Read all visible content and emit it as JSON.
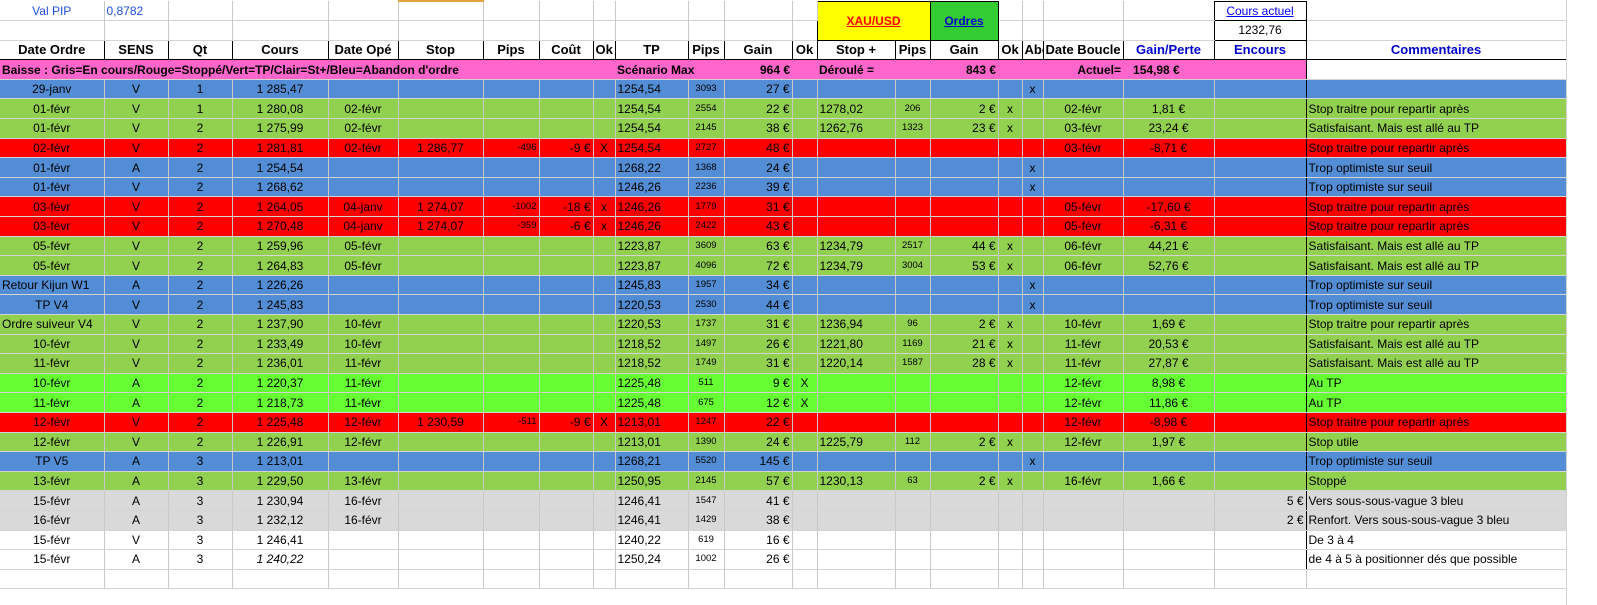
{
  "top": {
    "val_pip_label": "Val PIP",
    "val_pip_value": "0,8782",
    "xau_usd": "XAU/USD",
    "ordres": "Ordres",
    "cours_actuel_label": "Cours actuel",
    "cours_actuel_value": "1232,76"
  },
  "headers": [
    "Date Ordre",
    "SENS",
    "Qt",
    "Cours",
    "Date Opé",
    "Stop",
    "Pips",
    "Coût",
    "Ok",
    "TP",
    "Pips",
    "Gain",
    "Ok",
    "Stop +",
    "Pips",
    "Gain",
    "Ok",
    "Abd",
    "Date Boucle",
    "Gain/Perte",
    "Encours",
    "Commentaires"
  ],
  "legend": {
    "text": "Baisse : Gris=En cours/Rouge=Stoppé/Vert=TP/Clair=St+/Bleu=Abandon d'ordre",
    "scenario_label": "Scénario Max",
    "scenario_value": "964 €",
    "deroule_label": "Déroulé =",
    "deroule_value": "843 €",
    "actuel_label": "Actuel=",
    "actuel_value": "154,98 €"
  },
  "rows": [
    {
      "s": "blue",
      "c": [
        "29-janv",
        "V",
        "1",
        "1 285,47",
        "",
        "",
        "",
        "",
        "",
        "1254,54",
        "3093",
        "27 €",
        "",
        "",
        "",
        "",
        "",
        "x",
        "",
        "",
        "",
        ""
      ]
    },
    {
      "s": "green",
      "c": [
        "01-févr",
        "V",
        "1",
        "1 280,08",
        "02-févr",
        "",
        "",
        "",
        "",
        "1254,54",
        "2554",
        "22 €",
        "",
        "1278,02",
        "206",
        "2 €",
        "x",
        "",
        "02-févr",
        "1,81 €",
        "",
        "Stop traitre pour repartir après"
      ]
    },
    {
      "s": "green",
      "c": [
        "01-févr",
        "V",
        "2",
        "1 275,99",
        "02-févr",
        "",
        "",
        "",
        "",
        "1254,54",
        "2145",
        "38 €",
        "",
        "1262,76",
        "1323",
        "23 €",
        "x",
        "",
        "03-févr",
        "23,24 €",
        "",
        "Satisfaisant. Mais est allé au TP"
      ]
    },
    {
      "s": "red",
      "c": [
        "02-févr",
        "V",
        "2",
        "1 281,81",
        "02-févr",
        "1 286,77",
        "-496",
        "-9 €",
        "X",
        "1254,54",
        "2727",
        "48 €",
        "",
        "",
        "",
        "",
        "",
        "",
        "03-févr",
        "-8,71 €",
        "",
        "Stop traitre pour repartir après"
      ]
    },
    {
      "s": "blue",
      "c": [
        "01-févr",
        "A",
        "2",
        "1 254,54",
        "",
        "",
        "",
        "",
        "",
        "1268,22",
        "1368",
        "24 €",
        "",
        "",
        "",
        "",
        "",
        "x",
        "",
        "",
        "",
        "Trop optimiste sur seuil"
      ]
    },
    {
      "s": "blue",
      "c": [
        "01-févr",
        "V",
        "2",
        "1 268,62",
        "",
        "",
        "",
        "",
        "",
        "1246,26",
        "2236",
        "39 €",
        "",
        "",
        "",
        "",
        "",
        "x",
        "",
        "",
        "",
        "Trop optimiste sur seuil"
      ]
    },
    {
      "s": "red",
      "c": [
        "03-févr",
        "V",
        "2",
        "1 264,05",
        "04-janv",
        "1 274,07",
        "-1002",
        "-18 €",
        "x",
        "1246,26",
        "1779",
        "31 €",
        "",
        "",
        "",
        "",
        "",
        "",
        "05-févr",
        "-17,60 €",
        "",
        "Stop traitre pour repartir après"
      ]
    },
    {
      "s": "red",
      "c": [
        "03-févr",
        "V",
        "2",
        "1 270,48",
        "04-janv",
        "1 274,07",
        "-359",
        "-6 €",
        "x",
        "1246,26",
        "2422",
        "43 €",
        "",
        "",
        "",
        "",
        "",
        "",
        "05-févr",
        "-6,31 €",
        "",
        "Stop traitre pour repartir après"
      ]
    },
    {
      "s": "green",
      "c": [
        "05-févr",
        "V",
        "2",
        "1 259,96",
        "05-févr",
        "",
        "",
        "",
        "",
        "1223,87",
        "3609",
        "63 €",
        "",
        "1234,79",
        "2517",
        "44 €",
        "x",
        "",
        "06-févr",
        "44,21 €",
        "",
        "Satisfaisant. Mais est allé au TP"
      ]
    },
    {
      "s": "green",
      "c": [
        "05-févr",
        "V",
        "2",
        "1 264,83",
        "05-févr",
        "",
        "",
        "",
        "",
        "1223,87",
        "4096",
        "72 €",
        "",
        "1234,79",
        "3004",
        "53 €",
        "x",
        "",
        "06-févr",
        "52,76 €",
        "",
        "Satisfaisant. Mais est allé au TP"
      ]
    },
    {
      "s": "blue",
      "c": [
        "Retour Kijun W1",
        "A",
        "2",
        "1 226,26",
        "",
        "",
        "",
        "",
        "",
        "1245,83",
        "1957",
        "34 €",
        "",
        "",
        "",
        "",
        "",
        "x",
        "",
        "",
        "",
        "Trop optimiste sur seuil"
      ]
    },
    {
      "s": "blue",
      "c": [
        "TP V4",
        "V",
        "2",
        "1 245,83",
        "",
        "",
        "",
        "",
        "",
        "1220,53",
        "2530",
        "44 €",
        "",
        "",
        "",
        "",
        "",
        "x",
        "",
        "",
        "",
        "Trop optimiste sur seuil"
      ]
    },
    {
      "s": "green",
      "c": [
        "Ordre suiveur V4",
        "V",
        "2",
        "1 237,90",
        "10-févr",
        "",
        "",
        "",
        "",
        "1220,53",
        "1737",
        "31 €",
        "",
        "1236,94",
        "96",
        "2 €",
        "x",
        "",
        "10-févr",
        "1,69 €",
        "",
        "Stop traitre pour repartir après"
      ]
    },
    {
      "s": "green",
      "c": [
        "10-févr",
        "V",
        "2",
        "1 233,49",
        "10-févr",
        "",
        "",
        "",
        "",
        "1218,52",
        "1497",
        "26 €",
        "",
        "1221,80",
        "1169",
        "21 €",
        "x",
        "",
        "11-févr",
        "20,53 €",
        "",
        "Satisfaisant. Mais est allé au TP"
      ]
    },
    {
      "s": "green",
      "c": [
        "11-févr",
        "V",
        "2",
        "1 236,01",
        "11-févr",
        "",
        "",
        "",
        "",
        "1218,52",
        "1749",
        "31 €",
        "",
        "1220,14",
        "1587",
        "28 €",
        "x",
        "",
        "11-févr",
        "27,87 €",
        "",
        "Satisfaisant. Mais est allé au TP"
      ]
    },
    {
      "s": "lgreen",
      "c": [
        "10-févr",
        "A",
        "2",
        "1 220,37",
        "11-févr",
        "",
        "",
        "",
        "",
        "1225,48",
        "511",
        "9 €",
        "X",
        "",
        "",
        "",
        "",
        "",
        "12-févr",
        "8,98 €",
        "",
        "Au TP"
      ]
    },
    {
      "s": "lgreen",
      "c": [
        "11-févr",
        "A",
        "2",
        "1 218,73",
        "11-févr",
        "",
        "",
        "",
        "",
        "1225,48",
        "675",
        "12 €",
        "X",
        "",
        "",
        "",
        "",
        "",
        "12-févr",
        "11,86 €",
        "",
        "Au TP"
      ]
    },
    {
      "s": "red",
      "c": [
        "12-févr",
        "V",
        "2",
        "1 225,48",
        "12-févr",
        "1 230,59",
        "-511",
        "-9 €",
        "X",
        "1213,01",
        "1247",
        "22 €",
        "",
        "",
        "",
        "",
        "",
        "",
        "12-févr",
        "-8,98 €",
        "",
        "Stop traitre pour repartir après"
      ]
    },
    {
      "s": "green",
      "c": [
        "12-févr",
        "V",
        "2",
        "1 226,91",
        "12-févr",
        "",
        "",
        "",
        "",
        "1213,01",
        "1390",
        "24 €",
        "",
        "1225,79",
        "112",
        "2 €",
        "x",
        "",
        "12-févr",
        "1,97 €",
        "",
        "Stop utile"
      ]
    },
    {
      "s": "blue",
      "c": [
        "TP V5",
        "A",
        "3",
        "1 213,01",
        "",
        "",
        "",
        "",
        "",
        "1268,21",
        "5520",
        "145 €",
        "",
        "",
        "",
        "",
        "",
        "x",
        "",
        "",
        "",
        "Trop optimiste sur seuil"
      ]
    },
    {
      "s": "green",
      "c": [
        "13-févr",
        "A",
        "3",
        "1 229,50",
        "13-févr",
        "",
        "",
        "",
        "",
        "1250,95",
        "2145",
        "57 €",
        "",
        "1230,13",
        "63",
        "2 €",
        "x",
        "",
        "16-févr",
        "1,66 €",
        "",
        "Stoppé"
      ]
    },
    {
      "s": "grey",
      "c": [
        "15-févr",
        "A",
        "3",
        "1 230,94",
        "16-févr",
        "",
        "",
        "",
        "",
        "1246,41",
        "1547",
        "41 €",
        "",
        "",
        "",
        "",
        "",
        "",
        "",
        "",
        "5 €",
        "Vers sous-sous-vague 3 bleu"
      ]
    },
    {
      "s": "grey",
      "c": [
        "16-févr",
        "A",
        "3",
        "1 232,12",
        "16-févr",
        "",
        "",
        "",
        "",
        "1246,41",
        "1429",
        "38 €",
        "",
        "",
        "",
        "",
        "",
        "",
        "",
        "",
        "2 €",
        "Renfort. Vers sous-sous-vague 3 bleu"
      ]
    },
    {
      "s": "white",
      "c": [
        "15-févr",
        "V",
        "3",
        "1 246,41",
        "",
        "",
        "",
        "",
        "",
        "1240,22",
        "619",
        "16 €",
        "",
        "",
        "",
        "",
        "",
        "",
        "",
        "",
        "",
        "De 3 à 4"
      ]
    },
    {
      "s": "white",
      "i": true,
      "c": [
        "15-févr",
        "A",
        "3",
        "1 240,22",
        "",
        "",
        "",
        "",
        "",
        "1250,24",
        "1002",
        "26 €",
        "",
        "",
        "",
        "",
        "",
        "",
        "",
        "",
        "",
        "de 4 à 5 à positionner dés que possible"
      ]
    }
  ]
}
